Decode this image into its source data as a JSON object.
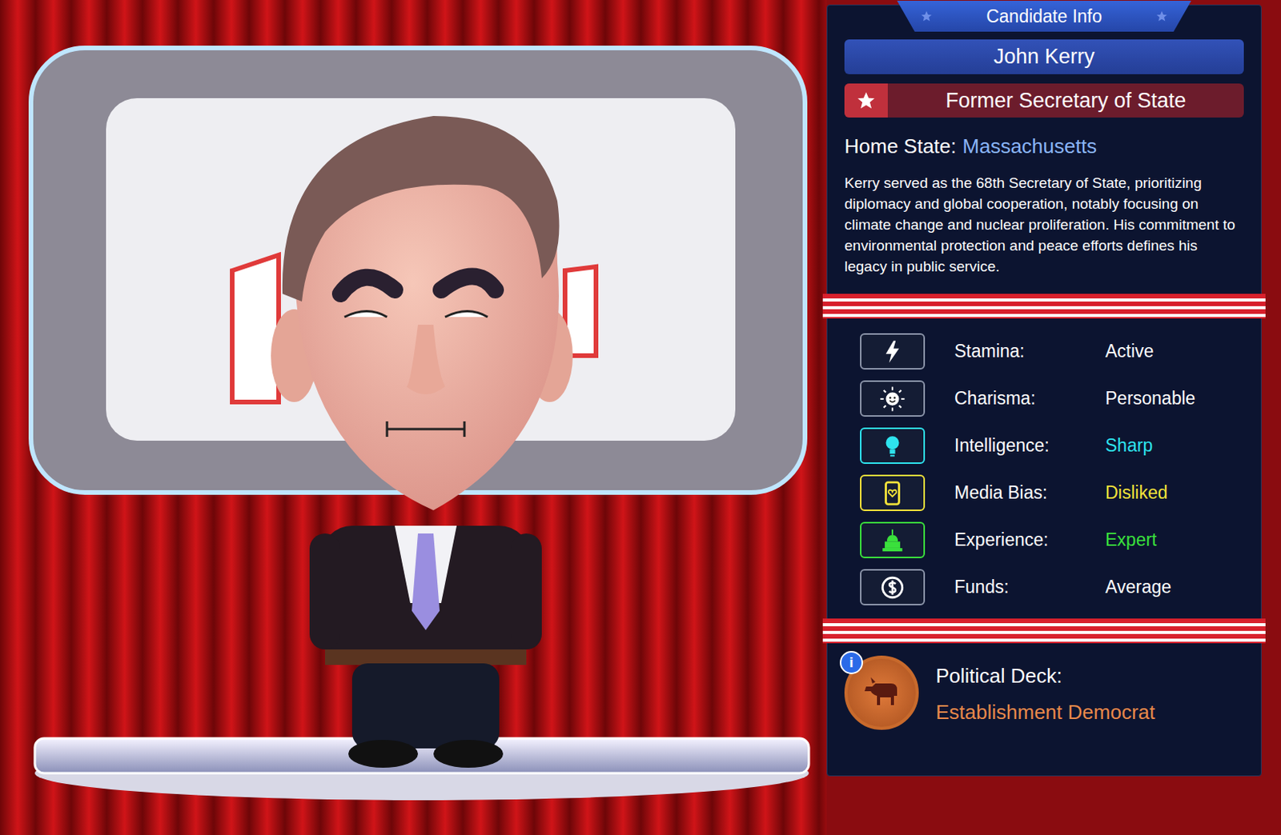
{
  "panel_title": "Candidate Info",
  "candidate": {
    "name": "John Kerry",
    "title": "Former Secretary of State",
    "home_state_label": "Home State:",
    "home_state": "Massachusetts",
    "bio": "Kerry served as the 68th Secretary of State, prioritizing diplomacy and global cooperation, notably focusing on climate change and nuclear proliferation. His commitment to environmental protection and peace efforts defines his legacy in public service."
  },
  "stats": [
    {
      "label": "Stamina:",
      "value": "Active",
      "color": "#ffffff"
    },
    {
      "label": "Charisma:",
      "value": "Personable",
      "color": "#ffffff"
    },
    {
      "label": "Intelligence:",
      "value": "Sharp",
      "color": "#2ee3ee"
    },
    {
      "label": "Media Bias:",
      "value": "Disliked",
      "color": "#f2e23a"
    },
    {
      "label": "Experience:",
      "value": "Expert",
      "color": "#3ae03c"
    },
    {
      "label": "Funds:",
      "value": "Average",
      "color": "#ffffff"
    }
  ],
  "deck": {
    "info": "i",
    "label": "Political Deck:",
    "value": "Establishment Democrat"
  }
}
